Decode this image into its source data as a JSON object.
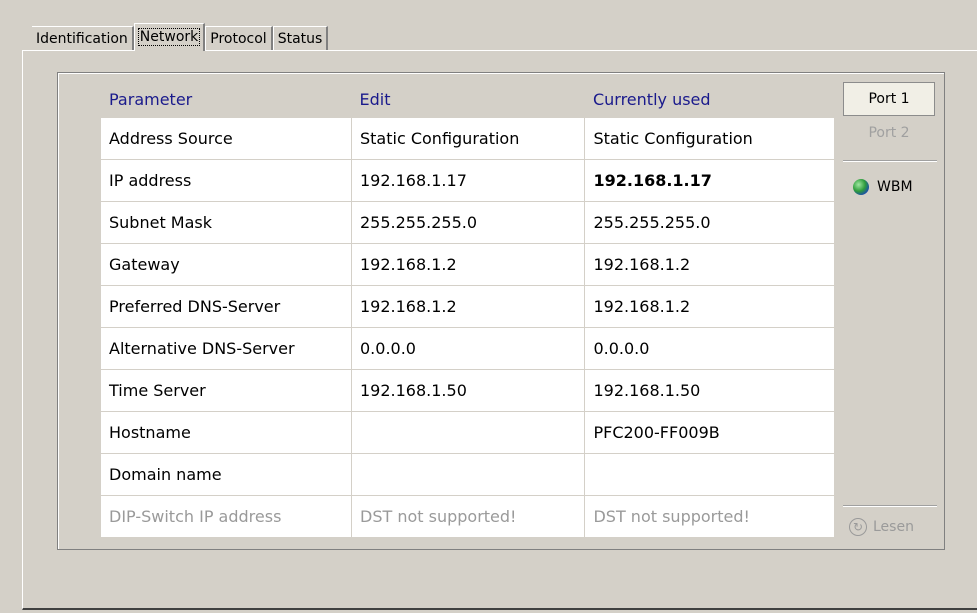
{
  "tabs": [
    "Identification",
    "Network",
    "Protocol",
    "Status"
  ],
  "active_tab": "Network",
  "table": {
    "headers": [
      "Parameter",
      "Edit",
      "Currently used"
    ],
    "rows": [
      [
        "Address Source",
        "Static Configuration",
        "Static Configuration"
      ],
      [
        "IP address",
        "192.168.1.17",
        "192.168.1.17"
      ],
      [
        "Subnet Mask",
        "255.255.255.0",
        "255.255.255.0"
      ],
      [
        "Gateway",
        "192.168.1.2",
        "192.168.1.2"
      ],
      [
        "Preferred DNS-Server",
        "192.168.1.2",
        "192.168.1.2"
      ],
      [
        "Alternative DNS-Server",
        "0.0.0.0",
        "0.0.0.0"
      ],
      [
        "Time Server",
        "192.168.1.50",
        "192.168.1.50"
      ],
      [
        "Hostname",
        "",
        "PFC200-FF009B"
      ],
      [
        "Domain name",
        "",
        ""
      ],
      [
        "DIP-Switch IP address",
        "DST not supported!",
        "DST not supported!"
      ]
    ]
  },
  "side": {
    "port1": "Port 1",
    "port2": "Port 2",
    "wbm": "WBM",
    "read": "Lesen"
  },
  "colors": {
    "header_text": "#1a1a8c",
    "panel_bg": "#d4d0c8",
    "disabled_text": "#9a9a9a"
  }
}
